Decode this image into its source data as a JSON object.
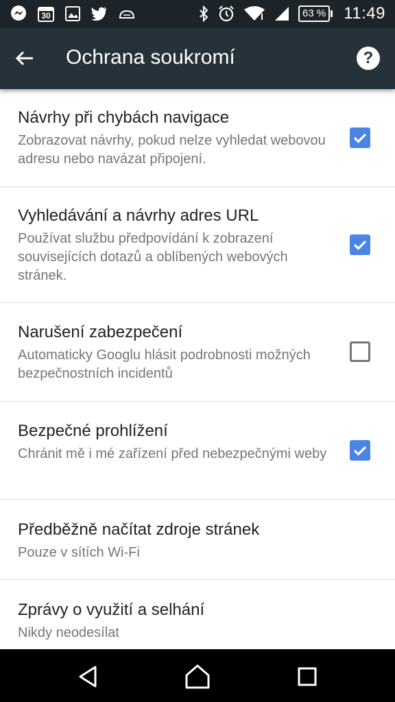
{
  "status_bar": {
    "icons": [
      "messenger-icon",
      "calendar-icon",
      "image-icon",
      "twitter-icon",
      "cloud-icon",
      "bluetooth-icon",
      "alarm-icon",
      "wifi-icon",
      "signal-icon"
    ],
    "calendar_day": "30",
    "battery": "63 %",
    "time": "11:49"
  },
  "app_bar": {
    "title": "Ochrana soukromí",
    "help_label": "?"
  },
  "settings": [
    {
      "title": "Návrhy při chybách navigace",
      "subtitle": "Zobrazovat návrhy, pokud nelze vyhledat webovou adresu nebo navázat připojení.",
      "checked": true
    },
    {
      "title": "Vyhledávání a návrhy adres URL",
      "subtitle": "Používat službu předpovídání k zobrazení souvisejících dotazů a oblíbených webových stránek.",
      "checked": true
    },
    {
      "title": "Narušení zabezpečení",
      "subtitle": "Automaticky Googlu hlásit podrobnosti možných bezpečnostních incidentů",
      "checked": false
    },
    {
      "title": "Bezpečné prohlížení",
      "subtitle": "Chránit mě i mé zařízení před nebezpečnými weby",
      "checked": true
    },
    {
      "title": "Předběžně načítat zdroje stránek",
      "subtitle": "Pouze v sítích Wi-Fi"
    },
    {
      "title": "Zprávy o využití a selhání",
      "subtitle": "Nikdy neodesílat"
    }
  ],
  "colors": {
    "status_bar": "#1c2429",
    "app_bar": "#26323a",
    "checkbox_accent": "#4a85e6"
  },
  "nav_bar": {
    "buttons": [
      "back-icon",
      "home-icon",
      "recents-icon"
    ]
  }
}
